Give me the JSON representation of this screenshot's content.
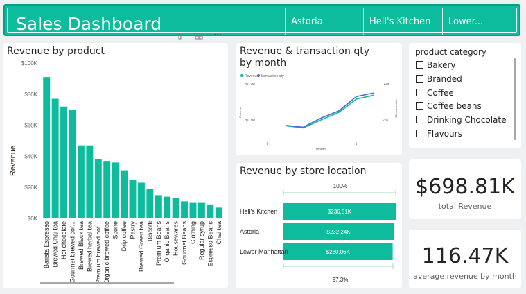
{
  "header": {
    "title": "Sales Dashboard",
    "tabs": [
      {
        "label": "Astoria"
      },
      {
        "label": "Hell's Kitchen"
      },
      {
        "label": "Lower..."
      }
    ]
  },
  "colors": {
    "accent": "#0dbc9c",
    "series2": "#4a6dcc",
    "background": "#eef0f1"
  },
  "icons": [
    "filter-icon",
    "focus-mode-icon",
    "more-options-icon"
  ],
  "chart_data": [
    {
      "type": "bar",
      "title": "Revenue by product",
      "ylabel": "Revenue",
      "xlabel": "",
      "ylim": [
        0,
        100000
      ],
      "yticks": [
        "$0K",
        "$20K",
        "$40K",
        "$60K",
        "$80K",
        "$100K"
      ],
      "categories": [
        "Barista Espresso",
        "Brewed Chai tea",
        "Hot chocolate",
        "Gourmet brewed cof...",
        "Brewed Black tea",
        "Brewed herbal tea",
        "Premium brewed cof...",
        "Organic brewed coffee",
        "Scone",
        "Drip coffee",
        "Pastry",
        "Brewed Green tea",
        "Biscotti",
        "Premium Beans",
        "Organic Beans",
        "Housewares",
        "Gourmet Beans",
        "Clothing",
        "Regular syrup",
        "Espresso Beans",
        "Chai tea"
      ],
      "values": [
        91000,
        77000,
        72000,
        70000,
        47000,
        47000,
        38000,
        37000,
        36000,
        31000,
        25000,
        23000,
        19000,
        15000,
        14000,
        13000,
        11000,
        10000,
        10000,
        9000,
        7000
      ]
    },
    {
      "type": "line",
      "title": "Revenue & transaction qty by month",
      "legend": [
        "Revenue",
        "transaction qty"
      ],
      "xlabel": "month",
      "ylabel": "Revenue",
      "y2label": "transaction qty",
      "x": [
        1,
        2,
        3,
        4,
        5,
        6
      ],
      "xticks": [
        "0",
        "5"
      ],
      "yticks": [
        "$0.1M",
        "$0.2M"
      ],
      "y2ticks": [
        "20K",
        "40K"
      ],
      "series": [
        {
          "name": "Revenue",
          "values": [
            82000,
            76000,
            98000,
            119000,
            156000,
            167000
          ]
        },
        {
          "name": "transaction qty",
          "values": [
            17000,
            16000,
            21000,
            25000,
            33000,
            35000
          ]
        }
      ]
    },
    {
      "type": "bar",
      "title": "Revenue by store location",
      "categories": [
        "Hell's Kitchen",
        "Astoria",
        "Lower Manhattan"
      ],
      "values": [
        236510,
        232240,
        230060
      ],
      "data_labels": [
        "$236.51K",
        "$232.24K",
        "$230.06K"
      ],
      "top_label": "100%",
      "bottom_label": "97.3%"
    }
  ],
  "slicer": {
    "title": "product category",
    "items": [
      "Bakery",
      "Branded",
      "Coffee",
      "Coffee beans",
      "Drinking Chocolate",
      "Flavours"
    ]
  },
  "kpis": [
    {
      "value": "$698.81K",
      "label": "total Revenue"
    },
    {
      "value": "116.47K",
      "label": "average revenue by month"
    }
  ]
}
